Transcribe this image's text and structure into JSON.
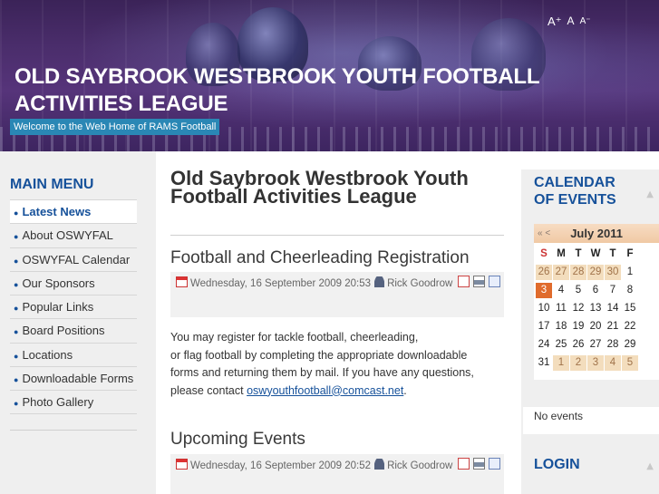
{
  "header": {
    "site_title": "Old Saybrook Westbrook Youth Football Activities League",
    "tagline": "Welcome to the Web Home of RAMS Football",
    "font_tools": {
      "larger": "A⁺",
      "reset": "A",
      "smaller": "A⁻"
    }
  },
  "left_menu": {
    "title": "MAIN MENU",
    "items": [
      {
        "label": "Latest News",
        "active": true
      },
      {
        "label": "About OSWYFAL"
      },
      {
        "label": "OSWYFAL Calendar"
      },
      {
        "label": "Our Sponsors"
      },
      {
        "label": "Popular Links"
      },
      {
        "label": "Board Positions"
      },
      {
        "label": "Locations"
      },
      {
        "label": "Downloadable Forms"
      },
      {
        "label": "Photo Gallery"
      }
    ]
  },
  "main": {
    "page_title": "Old Saybrook Westbrook Youth Football Activities League",
    "articles": [
      {
        "heading": "Football and Cheerleading Registration",
        "date": "Wednesday, 16 September 2009 20:53",
        "author": "Rick Goodrow",
        "body_lines": [
          "You may register for tackle football, cheerleading,",
          "or flag football by completing the appropriate downloadable",
          "forms and returning them by mail. If you have any questions,"
        ],
        "body_contact_prefix": "please contact ",
        "contact_email": "oswyouthfootball@comcast.net",
        "body_suffix": "."
      },
      {
        "heading": "Upcoming Events",
        "date": "Wednesday, 16 September 2009 20:52",
        "author": "Rick Goodrow"
      }
    ]
  },
  "right_sidebar": {
    "calendar_title_line1": "CALENDAR",
    "calendar_title_line2": "OF EVENTS",
    "calendar": {
      "nav_arrows": "« <",
      "month": "July 2011",
      "weekday_headers": [
        "S",
        "M",
        "T",
        "W",
        "T",
        "F"
      ],
      "weeks": [
        [
          "26",
          "27",
          "28",
          "29",
          "30",
          "1"
        ],
        [
          "3",
          "4",
          "5",
          "6",
          "7",
          "8"
        ],
        [
          "10",
          "11",
          "12",
          "13",
          "14",
          "15"
        ],
        [
          "17",
          "18",
          "19",
          "20",
          "21",
          "22"
        ],
        [
          "24",
          "25",
          "26",
          "27",
          "28",
          "29"
        ],
        [
          "31",
          "1",
          "2",
          "3",
          "4",
          "5"
        ]
      ],
      "today": "3"
    },
    "no_events_text": "No events",
    "login_title": "LOGIN"
  },
  "colors": {
    "accent_blue": "#16519a",
    "header_purple": "#4a2d6b",
    "tagline_bg": "#2a87b5",
    "today_orange": "#e06b2c",
    "other_month_bg": "#f3ddbd"
  }
}
